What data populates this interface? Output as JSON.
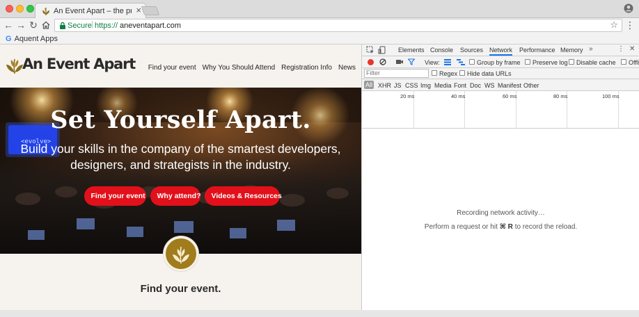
{
  "browser": {
    "tab": {
      "title": "An Event Apart – the premiere",
      "close": "×"
    },
    "address": {
      "secure_label": "Secure",
      "url_scheme": "https://",
      "url_host": "aneventapart.com"
    },
    "bookmarks": [
      {
        "icon": "G",
        "label": "Aquent Apps"
      }
    ]
  },
  "site": {
    "logo_text": "An Event Apart",
    "nav": [
      "Find your event",
      "Why You Should Attend",
      "Registration Info",
      "News"
    ],
    "hero": {
      "title": "Set Yourself Apart.",
      "subtitle": "Build your skills in the company of the smartest developers, designers, and strategists in the industry.",
      "buttons": [
        "Find your event",
        "Why attend?",
        "Videos & Resources"
      ],
      "sign_text": "<evolve>"
    },
    "section_title": "Find your event."
  },
  "devtools": {
    "tabs": [
      "Elements",
      "Console",
      "Sources",
      "Network",
      "Performance",
      "Memory"
    ],
    "active_tab": "Network",
    "more": "»",
    "toolbar": {
      "view_label": "View:",
      "group_by_frame": "Group by frame",
      "preserve_log": "Preserve log",
      "disable_cache": "Disable cache",
      "offline": "Offli"
    },
    "filter": {
      "placeholder": "Filter",
      "regex": "Regex",
      "hide_data_urls": "Hide data URLs"
    },
    "types": [
      "All",
      "XHR",
      "JS",
      "CSS",
      "Img",
      "Media",
      "Font",
      "Doc",
      "WS",
      "Manifest",
      "Other"
    ],
    "timeline_ticks": [
      "20 ms",
      "40 ms",
      "60 ms",
      "80 ms",
      "100 ms"
    ],
    "empty": {
      "line1": "Recording network activity…",
      "line2_prefix": "Perform a request or hit",
      "line2_key": "⌘ R",
      "line2_suffix": "to record the reload."
    }
  },
  "colors": {
    "hero_button": "#e2101a",
    "secure_green": "#0b8043",
    "devtools_active": "#1a73e8",
    "record_red": "#e8362a"
  }
}
